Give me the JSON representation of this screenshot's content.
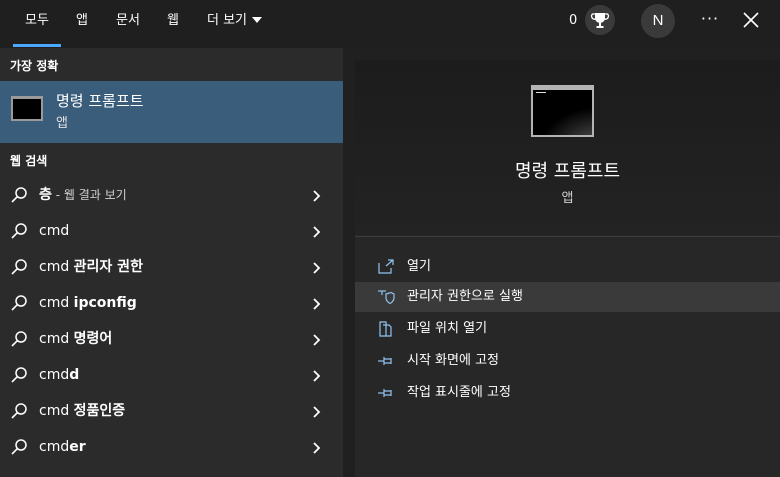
{
  "tabs": [
    {
      "label": "모두",
      "active": true
    },
    {
      "label": "앱"
    },
    {
      "label": "문서"
    },
    {
      "label": "웹"
    },
    {
      "label": "더 보기"
    }
  ],
  "header": {
    "points": "0",
    "avatar_initial": "N",
    "more_label": "···"
  },
  "best_match": {
    "heading": "가장 정확",
    "title": "명령 프롬프트",
    "subtitle": "앱"
  },
  "web_search": {
    "heading": "웹 검색",
    "items": [
      {
        "prefix": "",
        "bold": "층",
        "suffix": " - 웹 결과 보기"
      },
      {
        "prefix": "cmd",
        "bold": "",
        "suffix": ""
      },
      {
        "prefix": "cmd ",
        "bold": "관리자 권한",
        "suffix": ""
      },
      {
        "prefix": "cmd ",
        "bold": "ipconfig",
        "suffix": ""
      },
      {
        "prefix": "cmd ",
        "bold": "명령어",
        "suffix": ""
      },
      {
        "prefix": "cmd",
        "bold": "d",
        "suffix": ""
      },
      {
        "prefix": "cmd ",
        "bold": "정품인증",
        "suffix": ""
      },
      {
        "prefix": "cmd",
        "bold": "er",
        "suffix": ""
      }
    ]
  },
  "preview": {
    "title": "명령 프롬프트",
    "subtitle": "앱"
  },
  "actions": [
    {
      "label": "열기",
      "icon": "open-icon"
    },
    {
      "label": "관리자 권한으로 실행",
      "icon": "shield-icon"
    },
    {
      "label": "파일 위치 열기",
      "icon": "file-location-icon"
    },
    {
      "label": "시작 화면에 고정",
      "icon": "pin-icon"
    },
    {
      "label": "작업 표시줄에 고정",
      "icon": "pin-icon"
    }
  ],
  "colors": {
    "accent": "#4aa8ff",
    "selected_row": "#3b5d7c",
    "icon_accent": "#8fc3f0"
  }
}
